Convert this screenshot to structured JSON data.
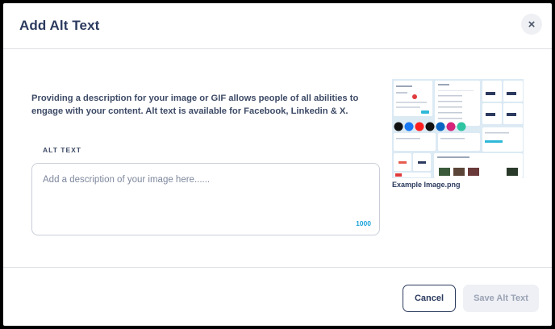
{
  "dialog": {
    "title": "Add Alt Text",
    "close_glyph": "×",
    "description": "Providing a description for your image or GIF allows people of all abilities to engage with your content. Alt text is available for Facebook, Linkedin & X.",
    "alt_text_label": "ALT TEXT",
    "alt_text_placeholder": "Add a description of your image here......",
    "alt_text_value": "",
    "char_counter": "1000",
    "preview_caption": "Example Image.png"
  },
  "footer": {
    "cancel_label": "Cancel",
    "save_label": "Save Alt Text"
  },
  "preview_icons": [
    "x-icon",
    "facebook-icon",
    "youtube-icon",
    "tiktok-icon",
    "linkedin-icon",
    "instagram-icon",
    "buffer-icon"
  ],
  "colors": {
    "title": "#2b3a5e",
    "accent": "#1aa3d9",
    "border": "#dcdfe4",
    "save_disabled_bg": "#eef0f5"
  }
}
